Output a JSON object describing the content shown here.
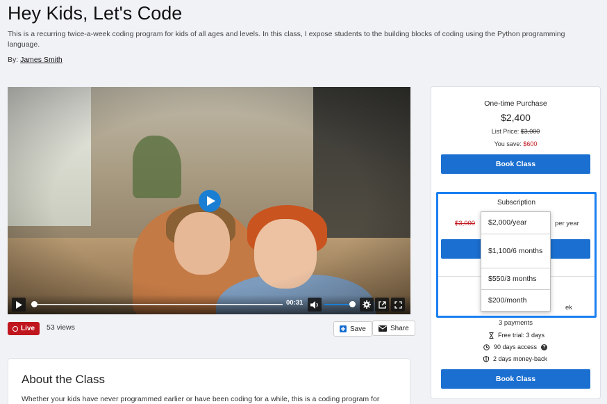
{
  "page": {
    "title": "Hey Kids, Let's Code",
    "description": "This is a recurring twice-a-week coding program for kids of all ages and levels. In this class, I expose students to the building blocks of coding using the Python programming language.",
    "by_label": "By:",
    "author": "James Smith"
  },
  "video": {
    "time": "00:31",
    "progress_fraction": 0.01,
    "volume_fraction": 0.9,
    "icons": [
      "play-icon",
      "volume-icon",
      "settings-icon",
      "external-link-icon",
      "fullscreen-icon"
    ]
  },
  "meta": {
    "live_label": "Live",
    "views": "53 views",
    "save_label": "Save",
    "share_label": "Share"
  },
  "about": {
    "heading": "About the Class",
    "text": "Whether your kids have never programmed earlier or have been coding for a while, this is a coding program for"
  },
  "one_time": {
    "title": "One-time Purchase",
    "price": "$2,400",
    "list_price_label": "List Price:",
    "list_price": "$3,000",
    "you_save_label": "You save:",
    "you_save": "$600",
    "button": "Book Class"
  },
  "subscription": {
    "title": "Subscription",
    "old_price": "$3,000",
    "per_label": "per year",
    "week_fragment": "ek",
    "options": [
      "$2,000/year",
      "$1,100/6 months",
      "$550/3 months",
      "$200/month"
    ]
  },
  "installments": {
    "payments": "3 payments",
    "features": [
      {
        "icon": "hourglass-icon",
        "text": "Free trial: 3 days"
      },
      {
        "icon": "clock-icon",
        "text": "90 days access"
      },
      {
        "icon": "shield-icon",
        "text": "2 days money-back"
      }
    ],
    "button": "Book Class"
  },
  "colors": {
    "accent": "#1a6fd0",
    "highlight_border": "#1a7ff0",
    "live": "#c0171f"
  }
}
